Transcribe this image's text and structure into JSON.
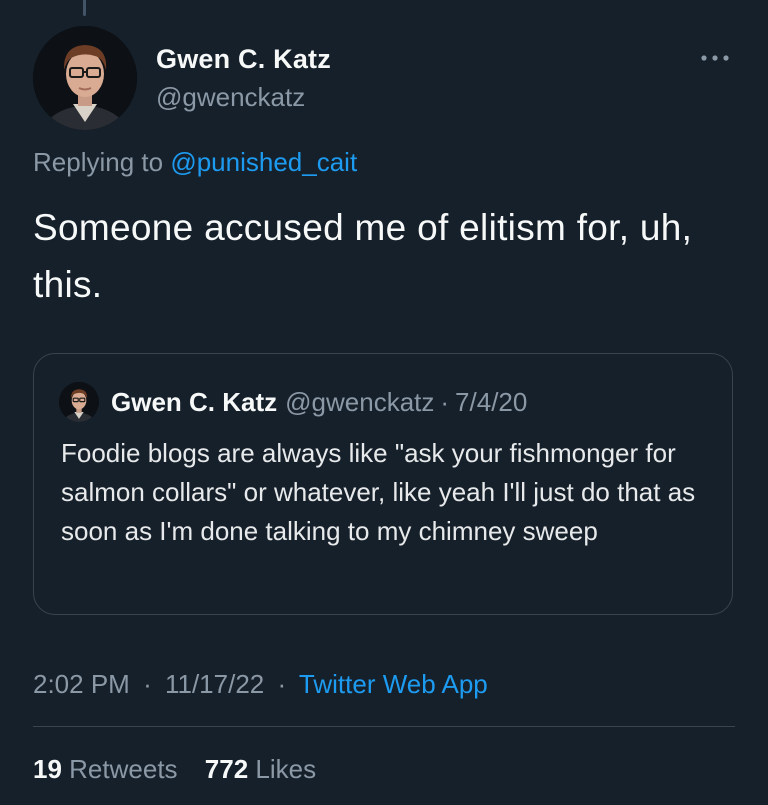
{
  "tweet": {
    "author_name": "Gwen C. Katz",
    "author_handle": "@gwenckatz",
    "replying_prefix": "Replying to",
    "replying_to": "@punished_cait",
    "text": "Someone accused me of elitism for, uh, this.",
    "time": "2:02 PM",
    "date": "11/17/22",
    "separator": "·",
    "source": "Twitter Web App",
    "more_icon": "more-horizontal-icon"
  },
  "quoted_tweet": {
    "author_name": "Gwen C. Katz",
    "author_handle": "@gwenckatz",
    "separator": "·",
    "date": "7/4/20",
    "text": "Foodie blogs are always like \"ask your fishmonger for salmon collars\" or whatever, like yeah I'll just do that as soon as I'm done talking to my chimney sweep"
  },
  "stats": {
    "retweets_count": "19",
    "retweets_label": "Retweets",
    "likes_count": "772",
    "likes_label": "Likes"
  },
  "colors": {
    "background": "#15202b",
    "accent": "#1d9bf0",
    "secondary_text": "#8b98a5",
    "border": "#38444d"
  }
}
